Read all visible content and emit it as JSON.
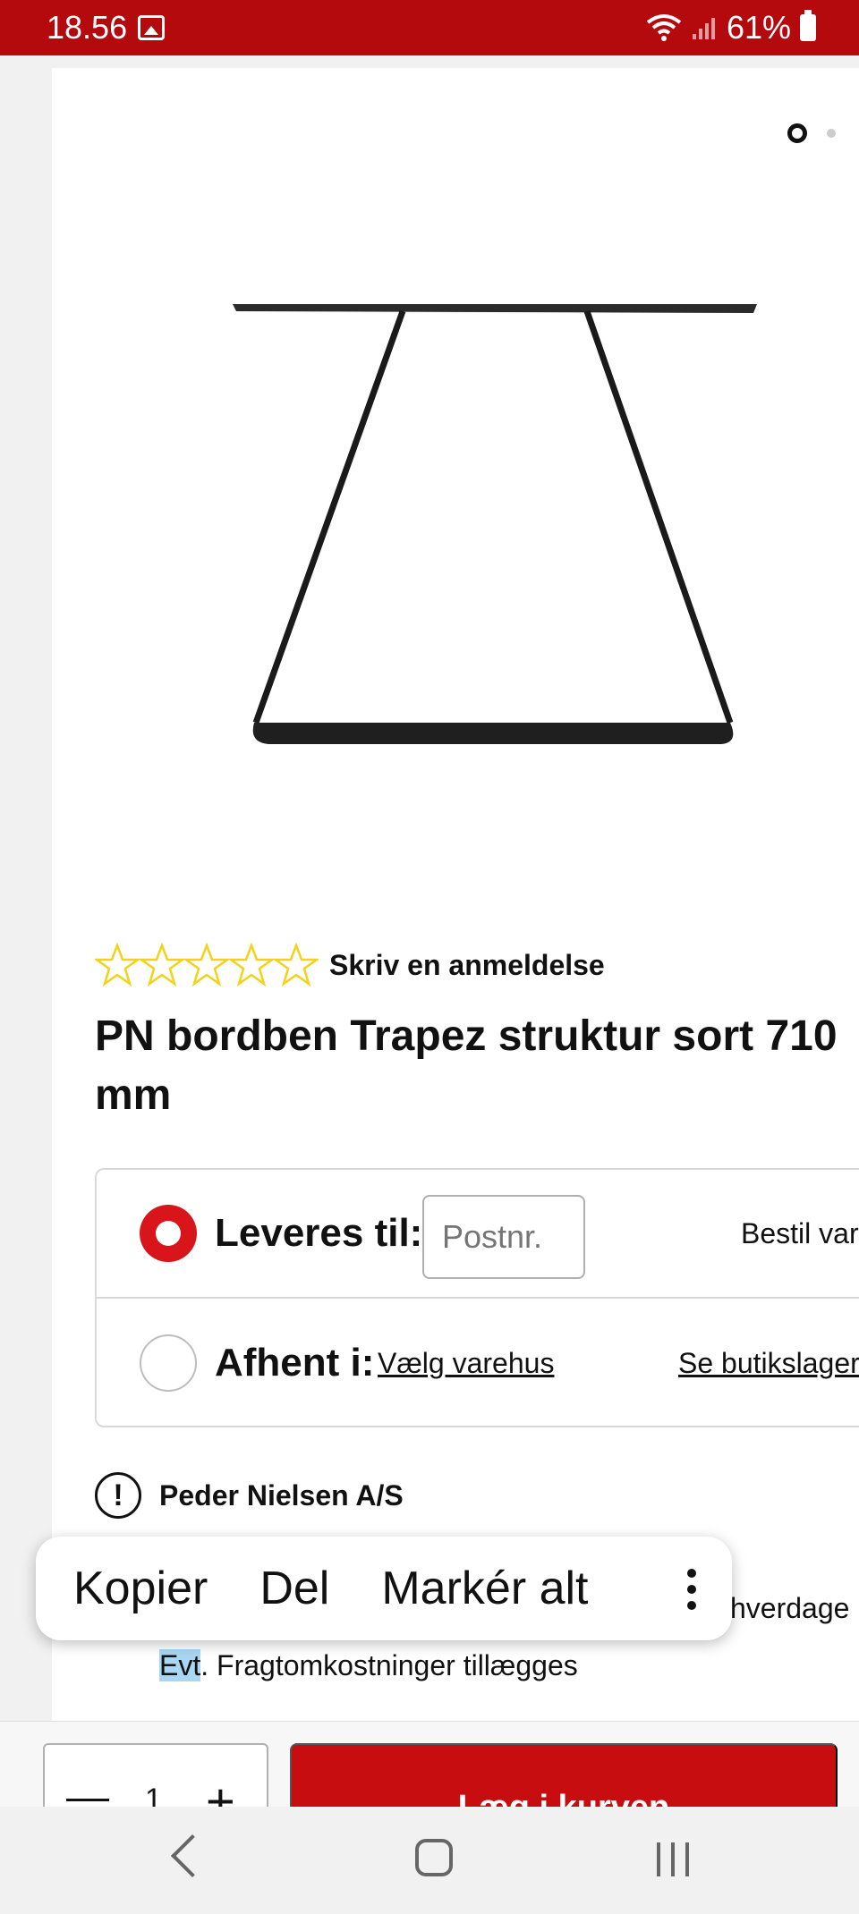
{
  "status_bar": {
    "time": "18.56",
    "battery": "61%"
  },
  "carousel": {
    "active_index": 1,
    "total": 2
  },
  "product": {
    "rating_link": "Skriv en anmeldelse",
    "rating_stars": 0,
    "title": "PN bordben Trapez struktur sort 710 mm"
  },
  "delivery": {
    "deliver_label": "Leveres til:",
    "postnr_placeholder": "Postnr.",
    "order_text": "Bestil var",
    "pickup_label": "Afhent i:",
    "choose_store": "Vælg varehus",
    "store_stock": "Se butikslager"
  },
  "supplier": {
    "name": "Peder Nielsen A/S"
  },
  "shipping": {
    "workdays_text": "hverdage",
    "freight_selected": "Evt",
    "freight_rest": ". Fragtomkostninger tillægges"
  },
  "context_menu": {
    "copy": "Kopier",
    "share": "Del",
    "select_all": "Markér alt"
  },
  "cart": {
    "quantity": "1",
    "add_to_cart": "Læg i kurven"
  },
  "colors": {
    "brand_red": "#c70d10",
    "status_red": "#b40a0e",
    "star_yellow": "#f2d21b"
  }
}
